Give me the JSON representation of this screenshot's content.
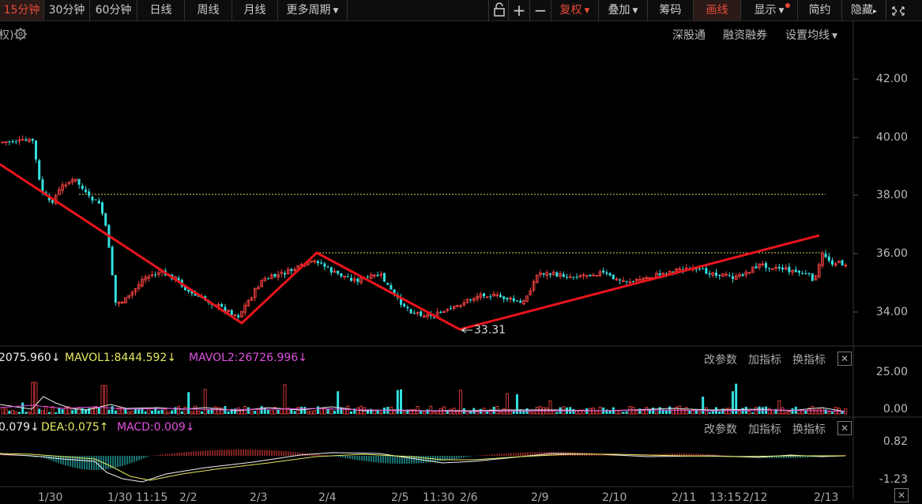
{
  "toolbar": {
    "periods": [
      "15分钟",
      "30分钟",
      "60分钟",
      "日线",
      "周线",
      "月线"
    ],
    "more_periods": "更多周期",
    "fuquan": "复权",
    "overlay": "叠加",
    "chips": "筹码",
    "draw": "画线",
    "display": "显示",
    "simple": "简约",
    "hide": "隐藏"
  },
  "subheader": {
    "left_fragment": "权)",
    "links": [
      "深股通",
      "融资融券",
      "设置均线"
    ]
  },
  "price_chart": {
    "y_ticks": [
      "42.00",
      "40.00",
      "38.00",
      "36.00",
      "34.00"
    ],
    "low_marker": "33.31",
    "colors": {
      "up": "#ff4444",
      "down": "#33e0e0",
      "trend": "#e8141c",
      "dotted": "#d8d860"
    }
  },
  "volume_panel": {
    "values": [
      "2075.960",
      "MAVOL1:8444.592",
      "MAVOL2:26726.996"
    ],
    "arrows": [
      "↓",
      "↓",
      "↓"
    ],
    "y_ticks": [
      "25.00",
      "0.00"
    ],
    "buttons": [
      "改参数",
      "加指标",
      "换指标"
    ]
  },
  "macd_panel": {
    "values": [
      "0.079",
      "DEA:0.075",
      "MACD:0.009"
    ],
    "arrows": [
      "↓",
      "↑",
      "↓"
    ],
    "y_ticks": [
      "0.82",
      "-1.23"
    ],
    "buttons": [
      "改参数",
      "加指标",
      "换指标"
    ]
  },
  "x_axis": {
    "labels": [
      "1/30",
      "1/30 11:15",
      "2/2",
      "2/3",
      "2/4",
      "2/5",
      "11:30",
      "2/6",
      "2/9",
      "2/10",
      "2/11",
      "13:15",
      "2/12",
      "2/13"
    ]
  }
}
